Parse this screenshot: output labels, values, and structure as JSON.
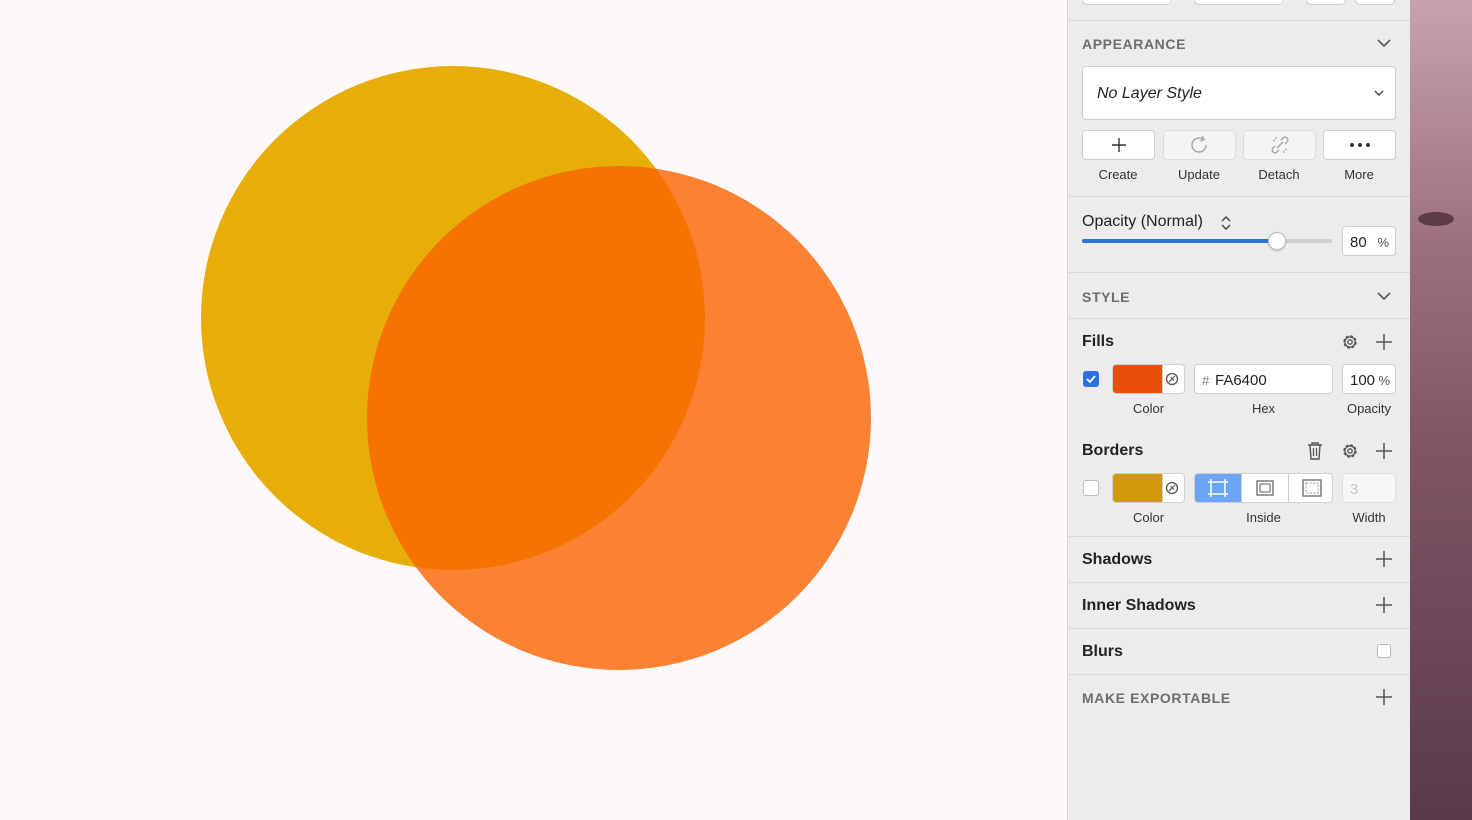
{
  "canvas": {
    "circles": [
      {
        "name": "yellow-circle",
        "color": "#e8ae08"
      },
      {
        "name": "orange-circle",
        "color": "#fa6400",
        "opacity": 0.8
      }
    ]
  },
  "appearance": {
    "title": "APPEARANCE",
    "layer_style": "No Layer Style",
    "buttons": [
      {
        "label": "Create",
        "icon": "plus-icon"
      },
      {
        "label": "Update",
        "icon": "refresh-icon"
      },
      {
        "label": "Detach",
        "icon": "unlink-icon"
      },
      {
        "label": "More",
        "icon": "ellipsis-icon"
      }
    ],
    "opacity_label": "Opacity (Normal)",
    "opacity_value": "80",
    "opacity_unit": "%",
    "opacity_level": 0.8
  },
  "style": {
    "title": "STYLE",
    "fills": {
      "title": "Fills",
      "enabled": true,
      "color": "#e84e0c",
      "hex_prefix": "#",
      "hex": "FA6400",
      "opacity": "100",
      "opacity_unit": "%",
      "captions": {
        "color": "Color",
        "hex": "Hex",
        "opacity": "Opacity"
      }
    },
    "borders": {
      "title": "Borders",
      "enabled": false,
      "color": "#d09a0c",
      "position": "Inside",
      "width_placeholder": "3",
      "captions": {
        "color": "Color",
        "position": "Inside",
        "width": "Width"
      }
    },
    "shadows": "Shadows",
    "inner_shadows": "Inner Shadows",
    "blurs": "Blurs"
  },
  "export": {
    "title": "MAKE EXPORTABLE"
  }
}
